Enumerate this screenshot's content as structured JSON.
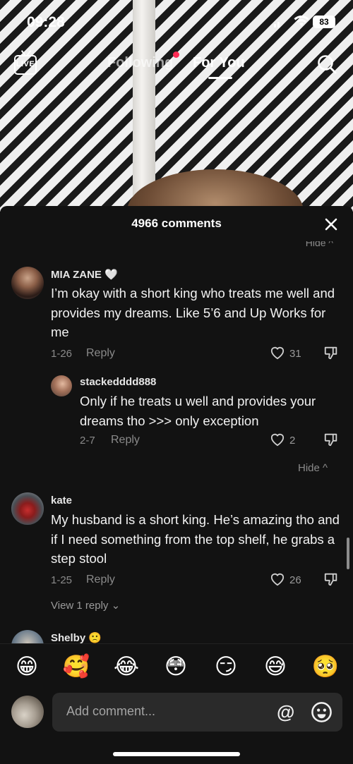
{
  "status_bar": {
    "time": "09:28",
    "battery": "83"
  },
  "top_nav": {
    "live_label": "LIVE",
    "tabs": [
      {
        "label": "Following",
        "active": false,
        "has_dot": true
      },
      {
        "label": "For You",
        "active": true
      }
    ]
  },
  "comments_sheet": {
    "count_label": "4966 comments",
    "collapsed_hide_label": "Hide",
    "comments": [
      {
        "username": "MIA ZANE 🤍",
        "text": "I’m okay with a short king who treats me well and provides my dreams. Like 5’6 and Up Works for me",
        "date": "1-26",
        "reply_label": "Reply",
        "likes": "31",
        "replies": [
          {
            "username": "stackedddd888",
            "text": "Only if he treats u well and provides your dreams tho >>> only exception",
            "date": "2-7",
            "reply_label": "Reply",
            "likes": "2"
          }
        ],
        "hide_label": "Hide"
      },
      {
        "username": "kate",
        "text": "My husband is a short king. He’s amazing tho and if I need something from the top shelf, he grabs a step stool",
        "date": "1-25",
        "reply_label": "Reply",
        "likes": "26",
        "view_replies_label": "View 1 reply"
      },
      {
        "username": "Shelby 🙁"
      }
    ]
  },
  "emoji_bar": [
    "😁",
    "🥰",
    "😂",
    "😳",
    "😏",
    "😅",
    "🥺"
  ],
  "comment_input": {
    "placeholder": "Add comment...",
    "at_symbol": "@"
  }
}
